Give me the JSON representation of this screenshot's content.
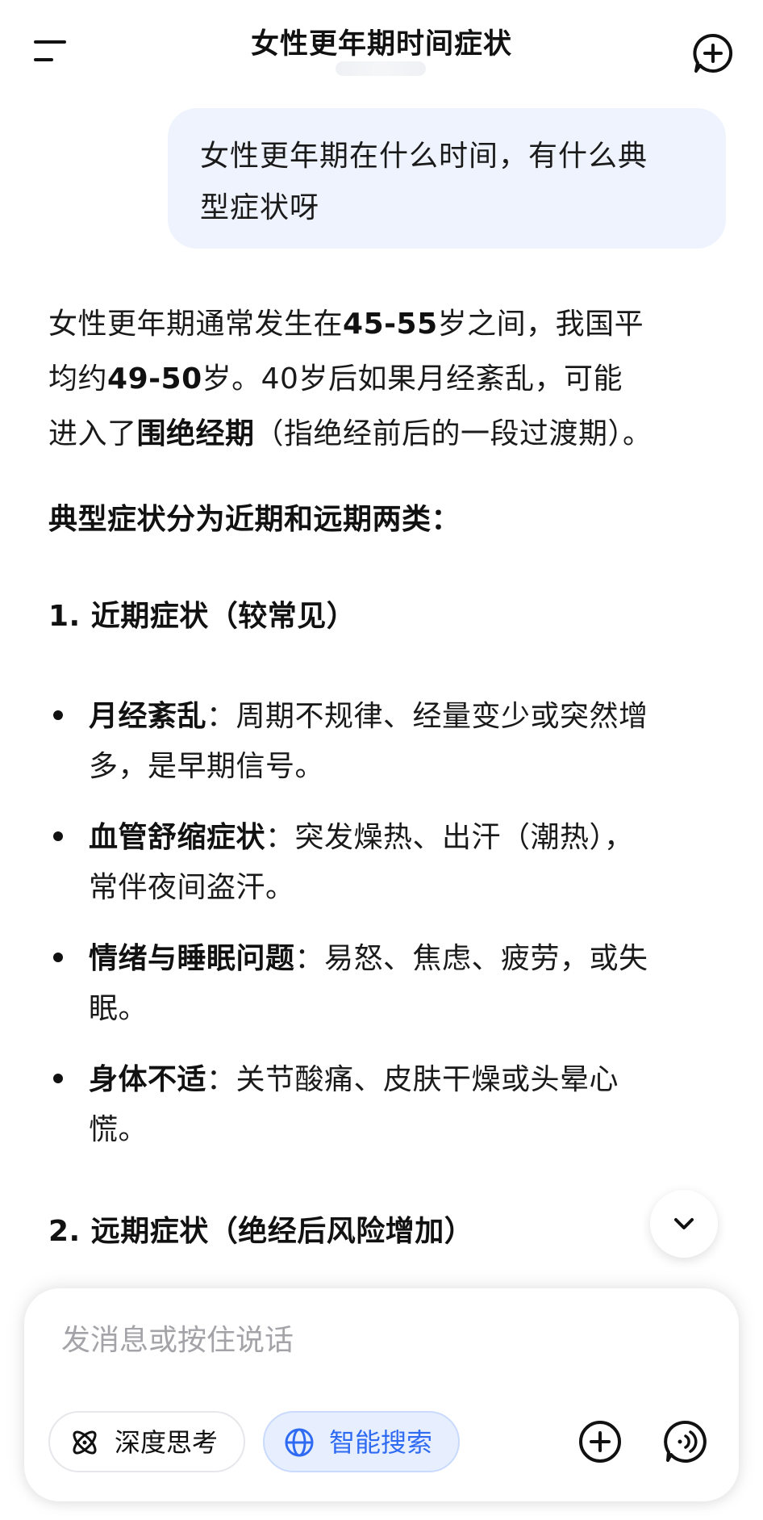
{
  "header": {
    "title": "女性更年期时间症状",
    "menu_icon": "menu-icon",
    "new_chat_icon": "new-chat-icon"
  },
  "user_message": {
    "line1": "女性更年期在什么时间，有什么典",
    "line2": "型症状呀"
  },
  "answer": {
    "intro": {
      "l1_a": "女性更年期通常发生在",
      "l1_b": "45-55",
      "l1_c": "岁之间，我国平",
      "l2_a": "均约",
      "l2_b": "49-50",
      "l2_c": "岁。40岁后如果月经紊乱，可能",
      "l3_a": "进入了",
      "l3_b": "围绝经期",
      "l3_c": "（指绝经前后的一段过渡期）。"
    },
    "types_heading": "典型症状分为近期和远期两类：",
    "section1": "1. 近期症状（较常见）",
    "items": [
      {
        "label": "月经紊乱",
        "text_l1": "：周期不规律、经量变少或突然增",
        "text_l2": "多，是早期信号。"
      },
      {
        "label": "血管舒缩症状",
        "text_l1": "：突发燥热、出汗（潮热），",
        "text_l2": "常伴夜间盗汗。"
      },
      {
        "label": "情绪与睡眠问题",
        "text_l1": "：易怒、焦虑、疲劳，或失",
        "text_l2": "眠。"
      },
      {
        "label": "身体不适",
        "text_l1": "：关节酸痛、皮肤干燥或头晕心",
        "text_l2": "慌。"
      }
    ],
    "section2": "2. 远期症状（绝经后风险增加）"
  },
  "composer": {
    "placeholder": "发消息或按住说话",
    "deep_think_label": "深度思考",
    "smart_search_label": "智能搜索",
    "accent": "#2f6bf2"
  }
}
